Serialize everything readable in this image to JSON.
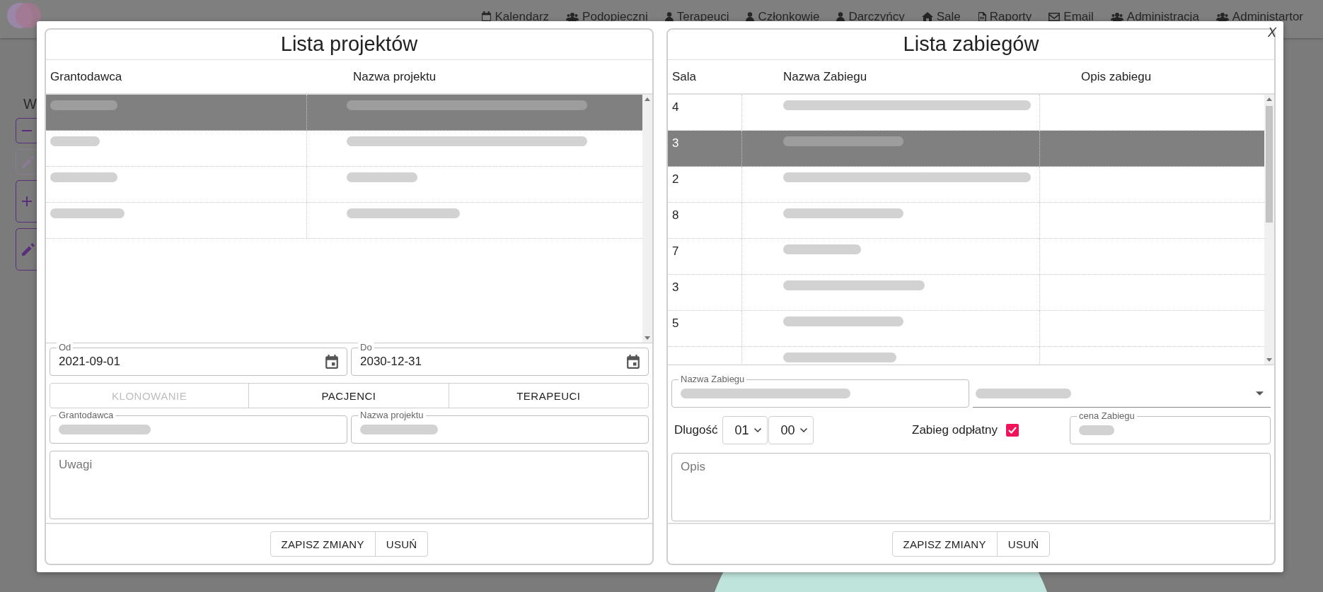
{
  "navbar": {
    "items": [
      {
        "kind": "calendar",
        "label": "Kalendarz"
      },
      {
        "kind": "group",
        "label": "Podopieczni"
      },
      {
        "kind": "person",
        "label": "Terapeuci"
      },
      {
        "kind": "person",
        "label": "Członkowie"
      },
      {
        "kind": "person",
        "label": "Darczyńcy"
      },
      {
        "kind": "home",
        "label": "Sale"
      },
      {
        "kind": "report",
        "label": "Raporty"
      },
      {
        "kind": "mail",
        "label": "Email"
      },
      {
        "kind": "group",
        "label": "Administracja"
      },
      {
        "kind": "group",
        "label": "Administartor"
      }
    ]
  },
  "background": {
    "heading": "W",
    "tools": [
      {
        "kind": "minus",
        "disabled": false
      },
      {
        "kind": "pencil",
        "disabled": true
      },
      {
        "kind": "plus",
        "disabled": false
      },
      {
        "kind": "pencil",
        "disabled": false
      }
    ]
  },
  "modal": {
    "close": "X"
  },
  "projects": {
    "title": "Lista projektów",
    "columns": [
      "Grantodawca",
      "Nazwa projektu"
    ],
    "rows": [
      {
        "selected": true,
        "cells": [
          {
            "blurred": true
          },
          {
            "blurred": true
          }
        ]
      },
      {
        "selected": false,
        "cells": [
          {
            "blurred": true
          },
          {
            "blurred": true
          }
        ]
      },
      {
        "selected": false,
        "cells": [
          {
            "blurred": true
          },
          {
            "blurred": true
          }
        ]
      },
      {
        "selected": false,
        "cells": [
          {
            "blurred": true
          },
          {
            "blurred": true
          }
        ]
      }
    ],
    "from": {
      "label": "Od",
      "value": "2021-09-01"
    },
    "to": {
      "label": "Do",
      "value": "2030-12-31"
    },
    "actions": [
      {
        "label": "KLONOWANIE",
        "disabled": true
      },
      {
        "label": "PACJENCI",
        "disabled": false
      },
      {
        "label": "TERAPEUCI",
        "disabled": false
      }
    ],
    "fields": [
      {
        "label": "Grantodawca",
        "blurred": true
      },
      {
        "label": "Nazwa projektu",
        "blurred": true
      }
    ],
    "notes": {
      "placeholder": "Uwagi"
    },
    "buttons": [
      "ZAPISZ ZMIANY",
      "USUŃ"
    ]
  },
  "treatments": {
    "title": "Lista zabiegów",
    "columns": [
      "Sala",
      "Nazwa Zabiegu",
      "Opis zabiegu"
    ],
    "rows": [
      {
        "selected": false,
        "cells": [
          {
            "text": "4"
          },
          {
            "blurred": true
          },
          null
        ]
      },
      {
        "selected": true,
        "cells": [
          {
            "text": "3"
          },
          {
            "blurred": true
          },
          null
        ]
      },
      {
        "selected": false,
        "cells": [
          {
            "text": "2"
          },
          {
            "blurred": true
          },
          null
        ]
      },
      {
        "selected": false,
        "cells": [
          {
            "text": "8"
          },
          {
            "blurred": true
          },
          null
        ]
      },
      {
        "selected": false,
        "cells": [
          {
            "text": "7"
          },
          {
            "blurred": true
          },
          null
        ]
      },
      {
        "selected": false,
        "cells": [
          {
            "text": "3"
          },
          {
            "blurred": true
          },
          null
        ]
      },
      {
        "selected": false,
        "cells": [
          {
            "text": "5"
          },
          {
            "blurred": true
          },
          null
        ]
      },
      {
        "selected": false,
        "cells": [
          null,
          {
            "blurred": true
          },
          null
        ]
      }
    ],
    "form": {
      "name": {
        "label": "Nazwa Zabiegu",
        "blurred": true
      },
      "room": {
        "blurred": true
      },
      "duration": {
        "label": "Dlugość",
        "hours": "01",
        "minutes": "00"
      },
      "paid": {
        "label": "Zabieg odpłatny",
        "checked": true
      },
      "price": {
        "label": "cena Zabiegu",
        "blurred": true
      },
      "notes": {
        "placeholder": "Opis"
      }
    },
    "buttons": [
      "ZAPISZ ZMIANY",
      "USUŃ"
    ]
  }
}
